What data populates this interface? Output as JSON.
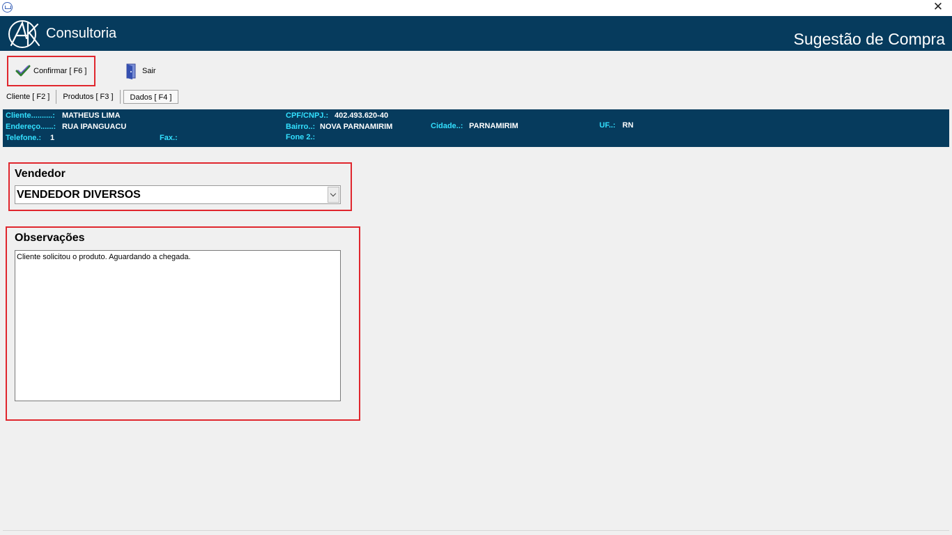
{
  "window": {
    "icon": "cart-icon",
    "close_label": "✕"
  },
  "header": {
    "brand": "Consultoria",
    "title": "Sugestão de Compra",
    "logo_icon": "afk-logo-icon",
    "colors": {
      "background": "#063b5d",
      "text": "#ffffff"
    }
  },
  "toolbar": {
    "confirm_label": "Confirmar [ F6 ]",
    "confirm_icon": "checkmark-icon",
    "exit_label": "Sair",
    "exit_icon": "door-exit-icon"
  },
  "tabs": [
    {
      "label": "Cliente [ F2 ]"
    },
    {
      "label": "Produtos [ F3 ]"
    },
    {
      "label": "Dados [ F4 ]",
      "active": true
    }
  ],
  "client": {
    "cliente_label": "Cliente..........:",
    "cliente_value": "MATHEUS LIMA",
    "cpf_label": "CPF/CNPJ.:",
    "cpf_value": "402.493.620-40",
    "endereco_label": "Endereço......:",
    "endereco_value": "RUA IPANGUACU",
    "bairro_label": "Bairro..:",
    "bairro_value": "NOVA PARNAMIRIM",
    "cidade_label": "Cidade..:",
    "cidade_value": "PARNAMIRIM",
    "uf_label": "UF..:",
    "uf_value": "RN",
    "telefone_label": "Telefone.:",
    "telefone_value": "1",
    "fax_label": "Fax.:",
    "fax_value": "",
    "fone2_label": "Fone 2.:",
    "fone2_value": "",
    "colors": {
      "label": "#33e0ff",
      "value": "#ffffff"
    }
  },
  "vendedor": {
    "label": "Vendedor",
    "selected": "VENDEDOR DIVERSOS"
  },
  "observacoes": {
    "label": "Observações",
    "value": "Cliente solicitou o produto. Aguardando a chegada. "
  },
  "highlight_color": "#e0262d"
}
